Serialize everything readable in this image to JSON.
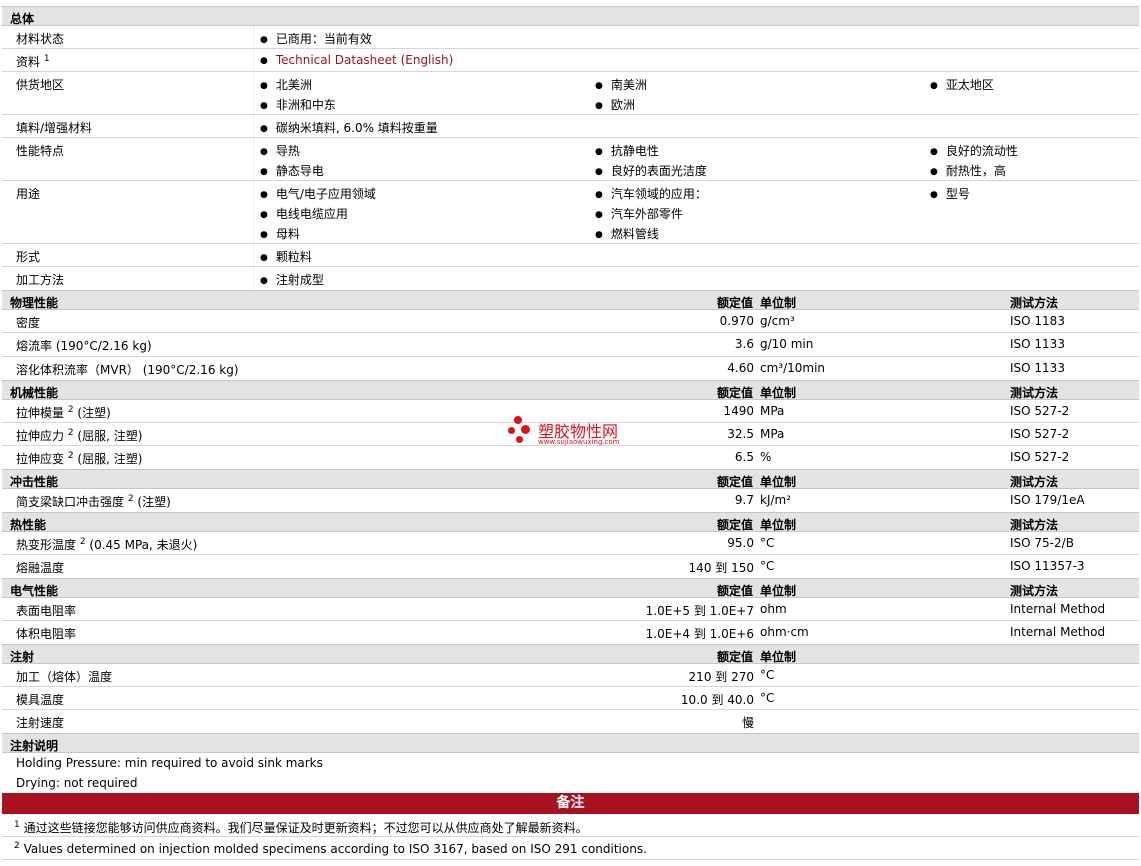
{
  "general": {
    "title": "总体",
    "material_status": {
      "label": "材料状态",
      "value": "已商用：当前有效"
    },
    "docs": {
      "label": "资料",
      "sup": "1",
      "link": "Technical Datasheet (English)"
    },
    "regions": {
      "label": "供货地区",
      "items": [
        "北美洲",
        "南美洲",
        "亚太地区",
        "非洲和中东",
        "欧洲"
      ]
    },
    "filler": {
      "label": "填料/增强材料",
      "value": "碳纳米填料, 6.0% 填料按重量"
    },
    "features": {
      "label": "性能特点",
      "items": [
        "导热",
        "抗静电性",
        "良好的流动性",
        "静态导电",
        "良好的表面光洁度",
        "耐热性，高"
      ]
    },
    "uses": {
      "label": "用途",
      "items": [
        "电气/电子应用领域",
        "汽车领域的应用：",
        "型号",
        "电线电缆应用",
        "汽车外部零件",
        "母料",
        "燃料管线"
      ]
    },
    "form": {
      "label": "形式",
      "value": "颗粒料"
    },
    "processing": {
      "label": "加工方法",
      "value": "注射成型"
    }
  },
  "headers": {
    "rated": "额定值",
    "unit": "单位制",
    "method": "测试方法"
  },
  "physical": {
    "title": "物理性能",
    "rows": [
      {
        "label": "密度",
        "sup": "",
        "cond": "",
        "value": "0.970",
        "unit": "g/cm³",
        "method": "ISO 1183"
      },
      {
        "label": "熔流率",
        "sup": "",
        "cond": " (190°C/2.16 kg)",
        "value": "3.6",
        "unit": "g/10 min",
        "method": "ISO 1133"
      },
      {
        "label": "溶化体积流率（MVR）",
        "sup": "",
        "cond": " (190°C/2.16 kg)",
        "value": "4.60",
        "unit": "cm³/10min",
        "method": "ISO 1133"
      }
    ]
  },
  "mechanical": {
    "title": "机械性能",
    "rows": [
      {
        "label": "拉伸模量",
        "sup": "2",
        "cond": " (注塑)",
        "value": "1490",
        "unit": "MPa",
        "method": "ISO 527-2"
      },
      {
        "label": "拉伸应力",
        "sup": "2",
        "cond": " (屈服, 注塑)",
        "value": "32.5",
        "unit": "MPa",
        "method": "ISO 527-2"
      },
      {
        "label": "拉伸应变",
        "sup": "2",
        "cond": " (屈服, 注塑)",
        "value": "6.5",
        "unit": "%",
        "method": "ISO 527-2"
      }
    ]
  },
  "impact": {
    "title": "冲击性能",
    "rows": [
      {
        "label": "简支梁缺口冲击强度",
        "sup": "2",
        "cond": " (注塑)",
        "value": "9.7",
        "unit": "kJ/m²",
        "method": "ISO 179/1eA"
      }
    ]
  },
  "thermal": {
    "title": "热性能",
    "rows": [
      {
        "label": "热变形温度",
        "sup": "2",
        "cond": " (0.45 MPa, 未退火)",
        "value": "95.0",
        "unit": "°C",
        "method": "ISO 75-2/B"
      },
      {
        "label": "熔融温度",
        "sup": "",
        "cond": "",
        "value": "140 到  150",
        "unit": "°C",
        "method": "ISO 11357-3"
      }
    ]
  },
  "electrical": {
    "title": "电气性能",
    "rows": [
      {
        "label": "表面电阻率",
        "sup": "",
        "cond": "",
        "value": "1.0E+5 到  1.0E+7",
        "unit": "ohm",
        "method": "Internal Method"
      },
      {
        "label": "体积电阻率",
        "sup": "",
        "cond": "",
        "value": "1.0E+4 到  1.0E+6",
        "unit": "ohm·cm",
        "method": "Internal Method"
      }
    ]
  },
  "injection": {
    "title": "注射",
    "rows": [
      {
        "label": "加工（熔体）温度",
        "sup": "",
        "cond": "",
        "value": "210 到  270",
        "unit": "°C",
        "method": ""
      },
      {
        "label": "模具温度",
        "sup": "",
        "cond": "",
        "value": "10.0 到  40.0",
        "unit": "°C",
        "method": ""
      },
      {
        "label": "注射速度",
        "sup": "",
        "cond": "",
        "value": "慢",
        "unit": "",
        "method": ""
      }
    ]
  },
  "injection_notes": {
    "title": "注射说明",
    "lines": [
      "Holding Pressure: min required to avoid sink marks",
      "Drying: not required"
    ]
  },
  "remarks": {
    "title": "备注",
    "footnotes": [
      {
        "num": "1",
        "text": "通过这些链接您能够访问供应商资料。我们尽量保证及时更新资料；不过您可以从供应商处了解最新资料。"
      },
      {
        "num": "2",
        "text": "Values determined on injection molded specimens according to ISO 3167, based on ISO 291 conditions."
      }
    ]
  },
  "watermark": {
    "name": "塑胶物性网",
    "url": "www.sujiaowuxing.com"
  }
}
